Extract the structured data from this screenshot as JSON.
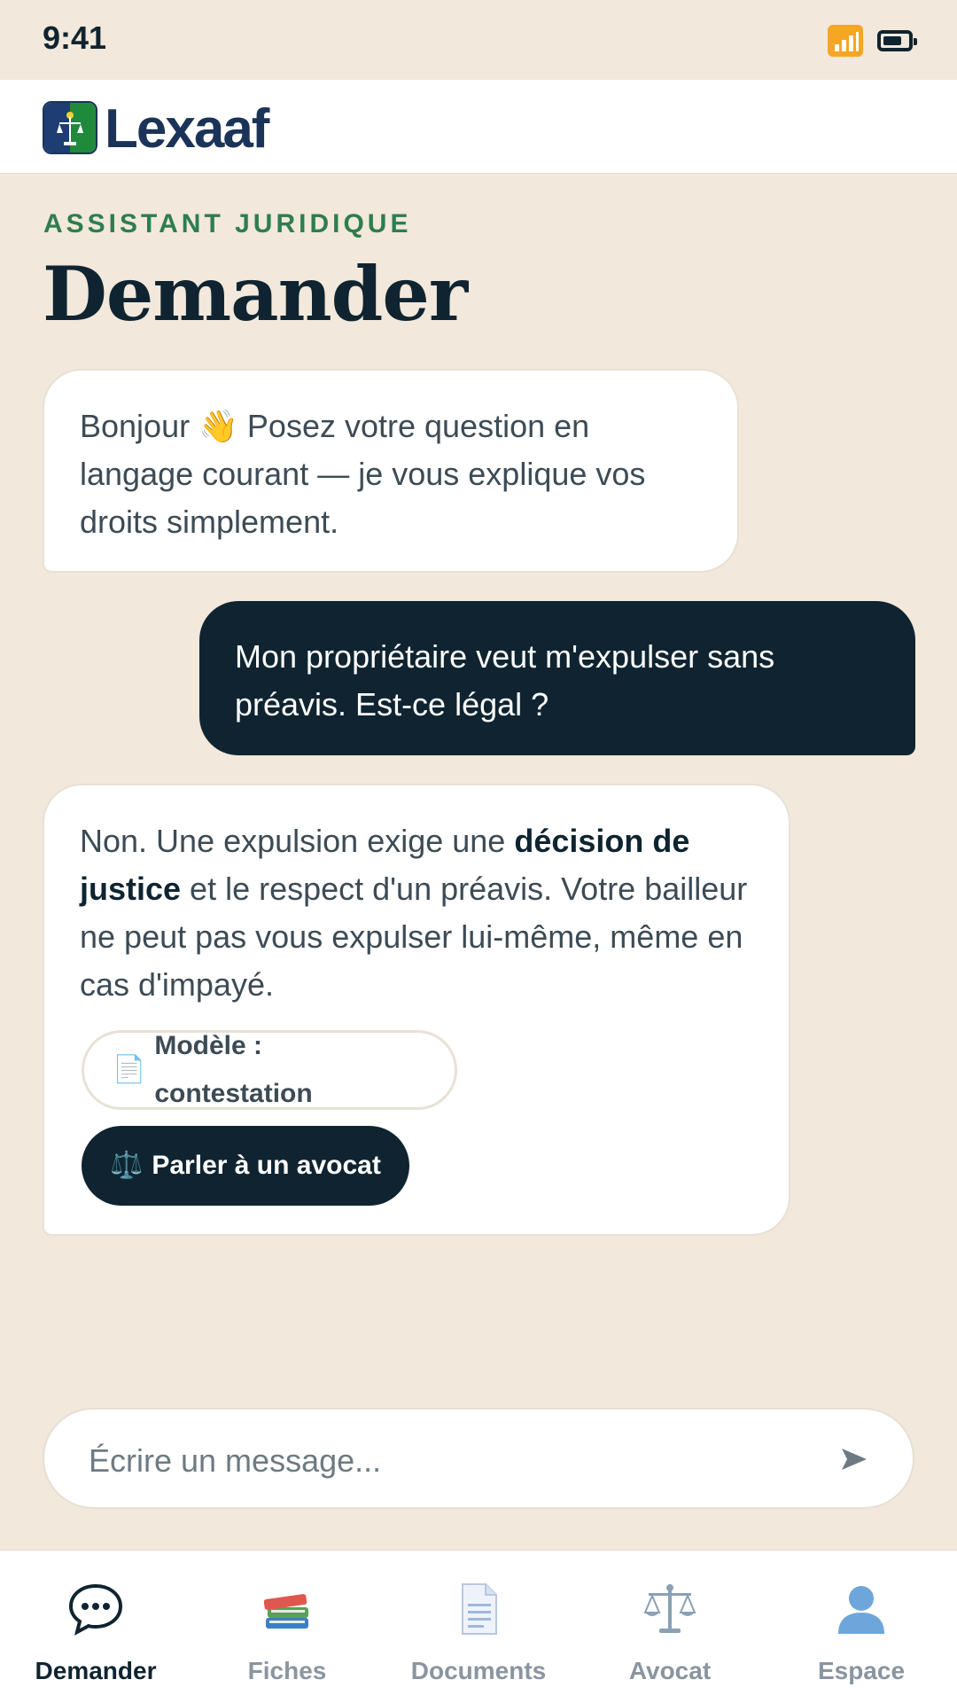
{
  "status_bar": {
    "time": "9:41"
  },
  "header": {
    "brand": "Lexaaf"
  },
  "page": {
    "kicker": "ASSISTANT JURIDIQUE",
    "title": "Demander"
  },
  "chat": {
    "messages": [
      {
        "role": "assistant",
        "text": "Bonjour 👋 Posez votre question en langage courant — je vous explique vos droits simplement."
      },
      {
        "role": "user",
        "text": "Mon propriétaire veut m'expulser sans préavis. Est-ce légal ?"
      },
      {
        "role": "assistant",
        "text_before": "Non. Une expulsion exige une ",
        "text_bold": "décision de justice",
        "text_after": " et le respect d'un préavis. Votre bailleur ne peut pas vous expulser lui-même, même en cas d'impayé.",
        "actions": [
          {
            "icon": "📄",
            "icon_name": "document-icon",
            "label": "Modèle : contestation"
          },
          {
            "icon": "⚖️",
            "icon_name": "scales-icon",
            "label": "Parler à un avocat"
          }
        ]
      }
    ]
  },
  "composer": {
    "placeholder": "Écrire un message..."
  },
  "nav": {
    "items": [
      {
        "label": "Demander",
        "icon": "💬",
        "icon_name": "chat-bubble-icon",
        "active": true
      },
      {
        "label": "Fiches",
        "icon": "📚",
        "icon_name": "books-icon",
        "active": false
      },
      {
        "label": "Documents",
        "icon": "📄",
        "icon_name": "document-icon",
        "active": false
      },
      {
        "label": "Avocat",
        "icon": "⚖️",
        "icon_name": "scales-icon",
        "active": false
      },
      {
        "label": "Espace",
        "icon": "👤",
        "icon_name": "user-icon",
        "active": false
      }
    ]
  },
  "colors": {
    "background": "#f2e8db",
    "ink": "#0f2430",
    "accent_green": "#2e7d4f",
    "brand_blue": "#1b3358"
  }
}
